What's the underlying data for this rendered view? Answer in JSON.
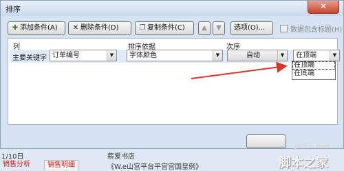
{
  "dialog": {
    "title": "排序",
    "close_label": "✕"
  },
  "toolbar": {
    "add_label": "添加条件(A)",
    "delete_label": "删除条件(D)",
    "copy_label": "复制条件(C)",
    "up_label": "▲",
    "down_label": "▼",
    "options_label": "选项(O)...",
    "header_check_label": "数据包含标题(H)"
  },
  "grid": {
    "col_header": "列",
    "basis_header": "排序依据",
    "order_header": "次序",
    "row": {
      "label": "主要关键字",
      "column_value": "订单编号",
      "basis_value": "字体颜色",
      "order_value": "自动",
      "position_value": "在顶端"
    }
  },
  "dropdown": {
    "options": [
      "在顶端",
      "在底端"
    ]
  },
  "background": {
    "row1_text": "1/10日",
    "row2_text": "薪爱书店",
    "row3_text": "《W.e山宫平台平宫宫国皇例》",
    "sheet_tab1": "销售分析",
    "sheet_tab2": "销售明细"
  },
  "watermark": {
    "url": "jb51.net",
    "text": "脚本之家"
  },
  "colors": {
    "dialog_bg": "#d6e3f2",
    "row_highlight": "#e1ebf7",
    "arrow": "#d9342b",
    "close_button": "#c8432b"
  }
}
